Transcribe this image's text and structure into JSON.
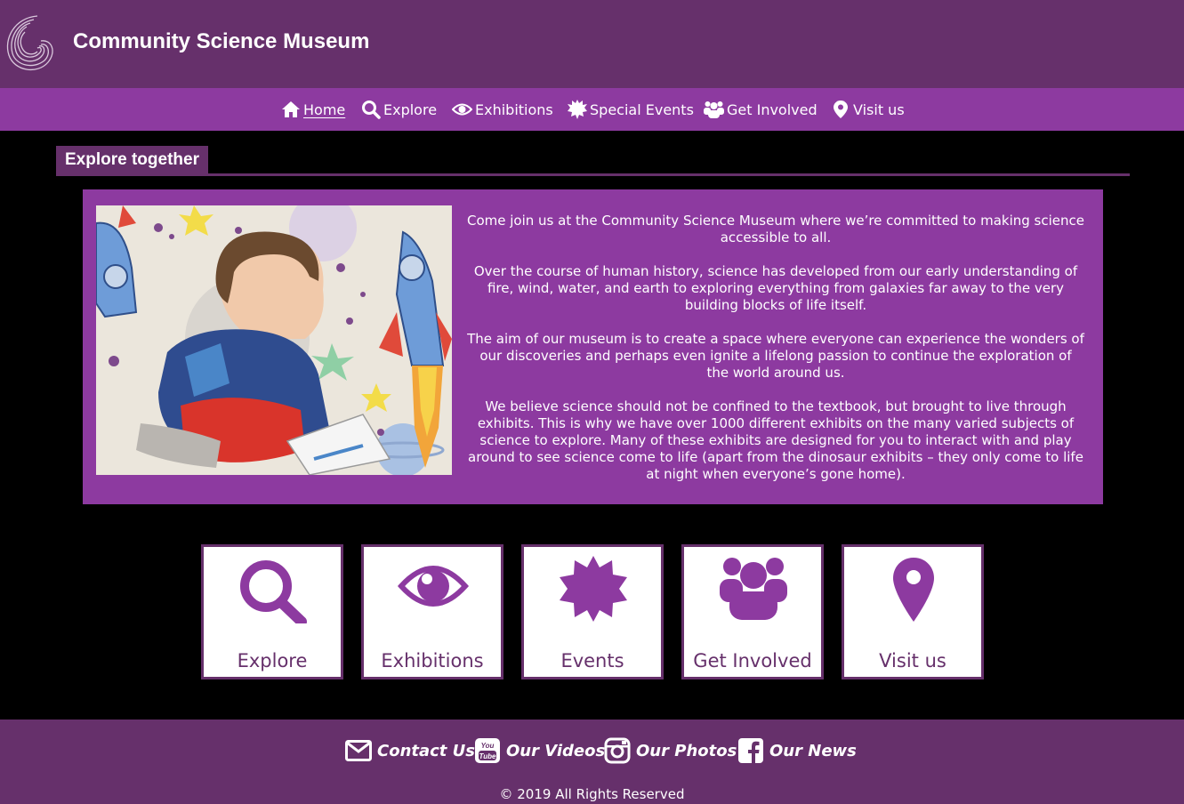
{
  "header": {
    "title": "Community Science Museum",
    "logo_icon": "spiral-logo-icon"
  },
  "nav": {
    "items": [
      {
        "label": "Home",
        "icon": "home-icon",
        "active": true
      },
      {
        "label": "Explore",
        "icon": "search-icon"
      },
      {
        "label": "Exhibitions",
        "icon": "eye-icon"
      },
      {
        "label": "Special Events",
        "icon": "starburst-icon"
      },
      {
        "label": "Get Involved",
        "icon": "users-icon"
      },
      {
        "label": "Visit us",
        "icon": "map-marker-icon"
      }
    ]
  },
  "section": {
    "title": "Explore together"
  },
  "intro": {
    "paragraphs": [
      "Come join us at the Community Science Museum where we’re committed to making science accessible to all.",
      "Over the course of human history, science has developed from our early understanding of fire, wind, water, and earth to exploring everything from galaxies far away to the very building blocks of life itself.",
      "The aim of our museum is to create a space where everyone can experience the wonders of our discoveries and perhaps even ignite a lifelong passion to continue the exploration of the world around us.",
      "We believe science should not be confined to the textbook, but brought to live through exhibits. This is why we have over 1000 different exhibits on the many varied subjects of science to explore. Many of these exhibits are designed for you to interact with and play around to see science come to life (apart from the dinosaur exhibits – they only come to life at night when everyone’s gone home)."
    ]
  },
  "tiles": [
    {
      "label": "Explore",
      "icon": "search-icon"
    },
    {
      "label": "Exhibitions",
      "icon": "eye-icon"
    },
    {
      "label": "Events",
      "icon": "starburst-icon"
    },
    {
      "label": "Get Involved",
      "icon": "users-icon"
    },
    {
      "label": "Visit us",
      "icon": "map-marker-icon"
    }
  ],
  "footer": {
    "links": [
      {
        "label": "Contact Us",
        "icon": "envelope-icon"
      },
      {
        "label": "Our Videos",
        "icon": "youtube-icon"
      },
      {
        "label": "Our Photos",
        "icon": "instagram-icon"
      },
      {
        "label": "Our News",
        "icon": "facebook-icon"
      }
    ],
    "copyright": "© 2019 All Rights Reserved"
  },
  "colors": {
    "header": "#66306b",
    "nav": "#8d3aa0",
    "accent": "#8d3aa0",
    "background": "#000000"
  }
}
